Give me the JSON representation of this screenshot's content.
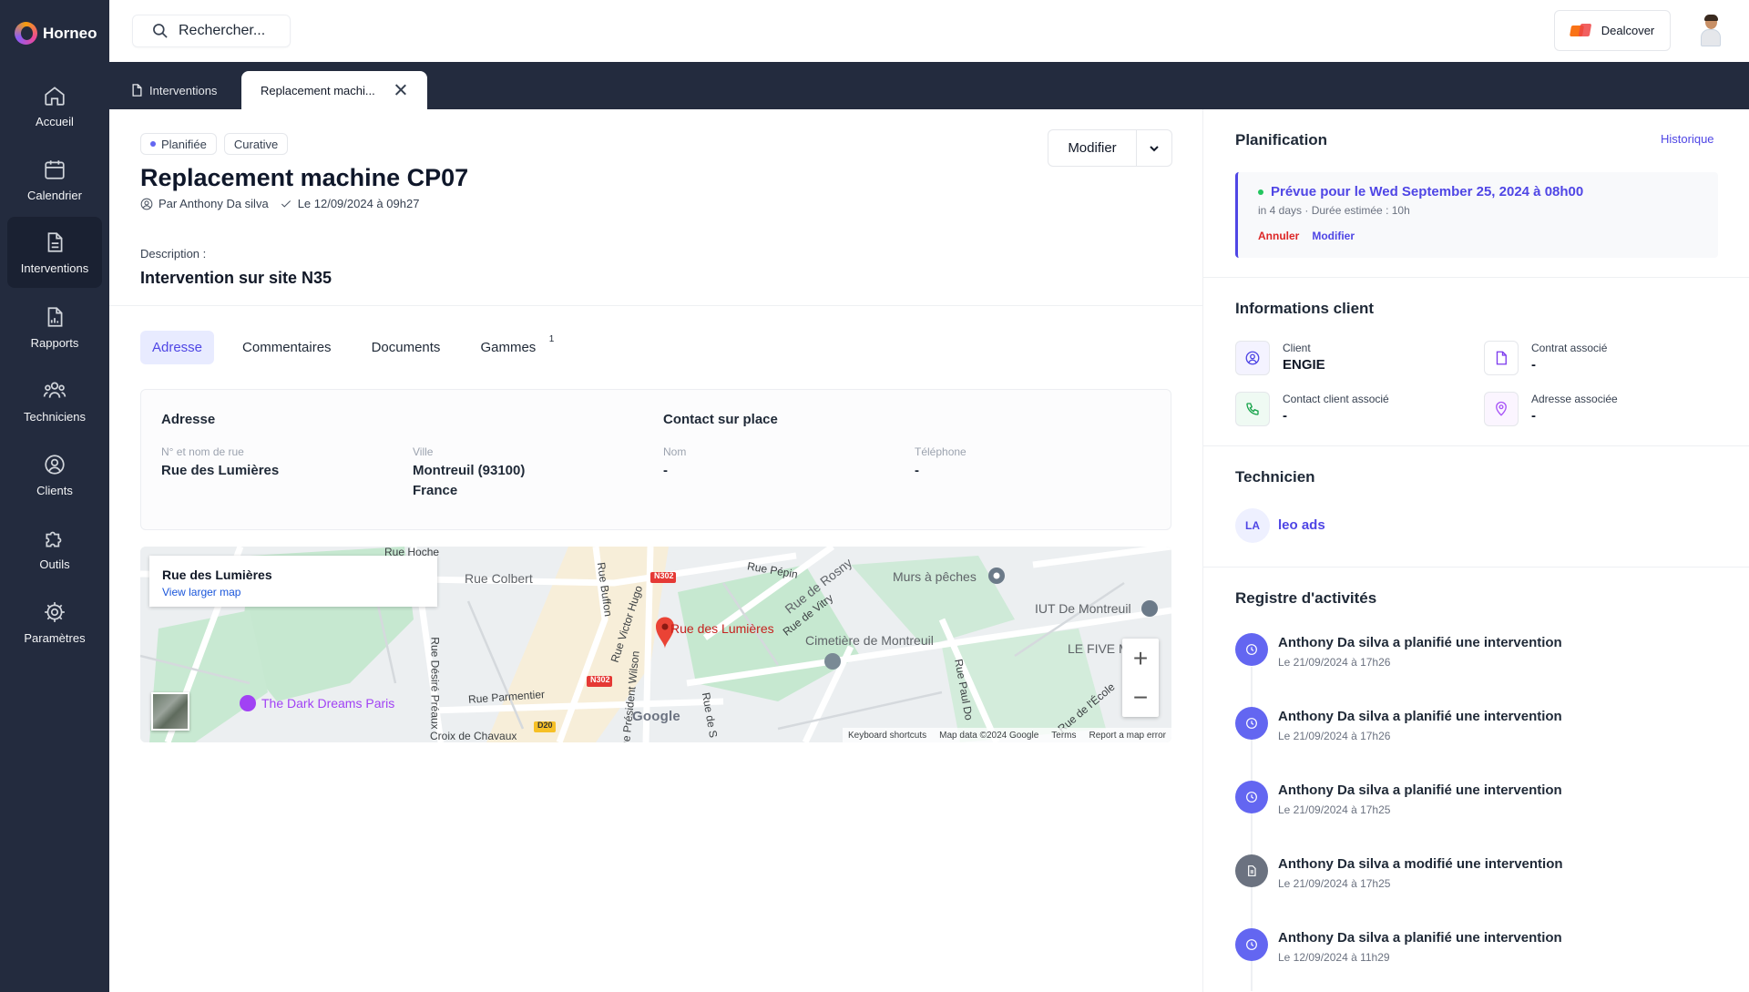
{
  "app": {
    "name": "Horneo"
  },
  "nav": [
    {
      "label": "Accueil",
      "icon": "home-icon"
    },
    {
      "label": "Calendrier",
      "icon": "calendar-icon"
    },
    {
      "label": "Interventions",
      "icon": "document-icon",
      "active": true
    },
    {
      "label": "Rapports",
      "icon": "report-icon"
    },
    {
      "label": "Techniciens",
      "icon": "users-icon"
    },
    {
      "label": "Clients",
      "icon": "user-circle-icon"
    },
    {
      "label": "Outils",
      "icon": "puzzle-icon"
    },
    {
      "label": "Paramètres",
      "icon": "gear-icon"
    }
  ],
  "topbar": {
    "search_placeholder": "Rechercher...",
    "company": "Dealcover"
  },
  "tabs": [
    {
      "label": "Interventions",
      "icon": "document-icon"
    },
    {
      "label": "Replacement machi...",
      "active": true
    }
  ],
  "intervention": {
    "badges": [
      "Planifiée",
      "Curative"
    ],
    "title": "Replacement machine CP07",
    "author": "Par Anthony Da silva",
    "date": "Le 12/09/2024 à 09h27",
    "modify_label": "Modifier",
    "description_label": "Description :",
    "description": "Intervention sur site N35"
  },
  "subtabs": [
    {
      "label": "Adresse",
      "active": true
    },
    {
      "label": "Commentaires"
    },
    {
      "label": "Documents"
    },
    {
      "label": "Gammes",
      "count": "1"
    }
  ],
  "address": {
    "heading": "Adresse",
    "street_label": "N° et nom de rue",
    "street": "Rue des Lumières",
    "city_label": "Ville",
    "city": "Montreuil (93100)",
    "country": "France"
  },
  "contact": {
    "heading": "Contact sur place",
    "name_label": "Nom",
    "name": "-",
    "phone_label": "Téléphone",
    "phone": "-"
  },
  "map": {
    "place": "Rue des Lumières",
    "larger_map": "View larger map",
    "labels": {
      "hoche": "Rue Hoche",
      "colbert": "Rue Colbert",
      "pepin": "Rue Pépin",
      "rosny": "Rue de Rosny",
      "murs": "Murs à pêches",
      "iut": "IUT De Montreuil",
      "buffon": "Rue Buffon",
      "hugo": "Rue Victor Hugo",
      "marker": "Rue des Lumières",
      "vitry": "Rue de Vitry",
      "cimetiere": "Cimetière de Montreuil",
      "fivem": "LE FIVE M",
      "preaux": "Rue Désiré Préaux",
      "parmentier": "Rue Parmentier",
      "dark": "The Dark Dreams Paris",
      "wilson": "Rue Président Wilson",
      "rue_s": "Rue de S",
      "paul": "Rue Paul Do",
      "ecole": "Rue de l'École",
      "croix": "Croix de Chavaux",
      "n302a": "N302",
      "n302b": "N302",
      "d20": "D20",
      "google": "Google"
    },
    "attribution": [
      "Keyboard shortcuts",
      "Map data ©2024 Google",
      "Terms",
      "Report a map error"
    ]
  },
  "planning": {
    "title": "Planification",
    "history_link": "Historique",
    "scheduled": "Prévue pour le Wed September 25, 2024 à 08h00",
    "sub": "in 4 days · Durée estimée : 10h",
    "cancel": "Annuler",
    "modify": "Modifier"
  },
  "client_info": {
    "title": "Informations client",
    "client_label": "Client",
    "client": "ENGIE",
    "contract_label": "Contrat associé",
    "contract": "-",
    "contact_label": "Contact client associé",
    "contact": "-",
    "address_label": "Adresse associée",
    "address": "-"
  },
  "technician": {
    "title": "Technicien",
    "initials": "LA",
    "name": "leo ads"
  },
  "activity": {
    "title": "Registre d'activités",
    "items": [
      {
        "text": "Anthony Da silva a planifié une intervention",
        "date": "Le 21/09/2024 à 17h26",
        "icon": "clock-icon"
      },
      {
        "text": "Anthony Da silva a planifié une intervention",
        "date": "Le 21/09/2024 à 17h26",
        "icon": "clock-icon"
      },
      {
        "text": "Anthony Da silva a planifié une intervention",
        "date": "Le 21/09/2024 à 17h25",
        "icon": "clock-icon"
      },
      {
        "text": "Anthony Da silva a modifié une intervention",
        "date": "Le 21/09/2024 à 17h25",
        "icon": "document-icon"
      },
      {
        "text": "Anthony Da silva a planifié une intervention",
        "date": "Le 12/09/2024 à 11h29",
        "icon": "clock-icon"
      }
    ]
  },
  "colors": {
    "accent": "#4f46e5",
    "sidebar": "#232b3e",
    "danger": "#dc2626",
    "success": "#16a34a",
    "activity_modified": "#6b7280"
  }
}
